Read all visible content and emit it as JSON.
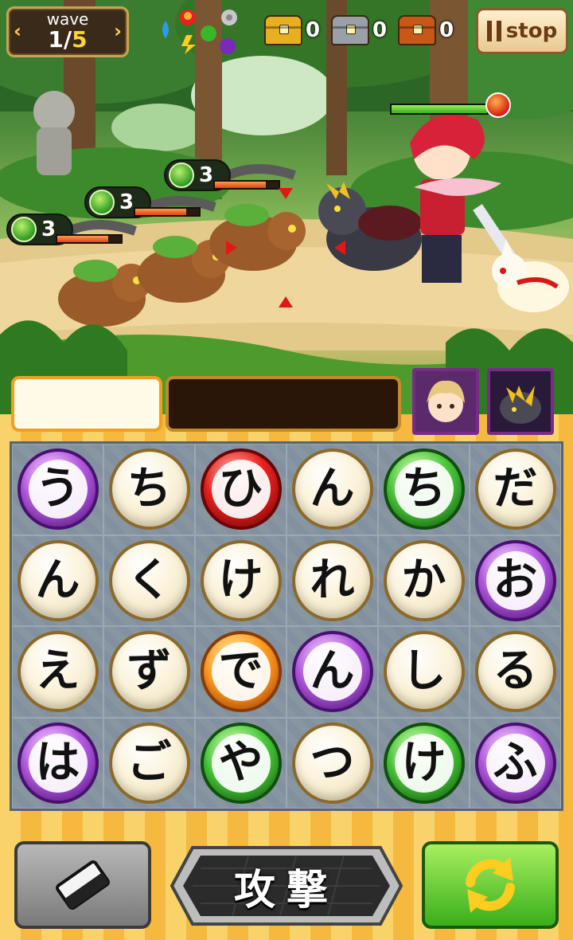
{
  "hud": {
    "wave_label": "wave",
    "wave_current": "1",
    "wave_sep": "/",
    "wave_total": "5",
    "element_icons": [
      "water-drop-icon",
      "fire-icon",
      "leaf-icon",
      "lightning-icon",
      "dark-icon",
      "flower-icon"
    ],
    "chests": [
      {
        "type": "gold-chest-icon",
        "count": "0",
        "color": "#e8b020"
      },
      {
        "type": "silver-chest-icon",
        "count": "0",
        "color": "#9aa0a8"
      },
      {
        "type": "bronze-chest-icon",
        "count": "0",
        "color": "#c8581a"
      }
    ],
    "stop_label": "stop"
  },
  "enemies": [
    {
      "level": "3",
      "hp": 0.8
    },
    {
      "level": "3",
      "hp": 0.8
    },
    {
      "level": "3",
      "hp": 0.8
    }
  ],
  "ally": {
    "hp": 1.0,
    "element": "fire"
  },
  "word_bar": {
    "current_word": ""
  },
  "party_portraits": [
    "blonde-girl-portrait",
    "dark-wolf-portrait"
  ],
  "grid": {
    "rows": [
      [
        {
          "char": "う",
          "color": "purple"
        },
        {
          "char": "ち",
          "color": "white"
        },
        {
          "char": "ひ",
          "color": "red"
        },
        {
          "char": "ん",
          "color": "white"
        },
        {
          "char": "ち",
          "color": "green"
        },
        {
          "char": "だ",
          "color": "white"
        }
      ],
      [
        {
          "char": "ん",
          "color": "white"
        },
        {
          "char": "く",
          "color": "white"
        },
        {
          "char": "け",
          "color": "white"
        },
        {
          "char": "れ",
          "color": "white"
        },
        {
          "char": "か",
          "color": "white"
        },
        {
          "char": "お",
          "color": "purple"
        }
      ],
      [
        {
          "char": "え",
          "color": "white"
        },
        {
          "char": "ず",
          "color": "white"
        },
        {
          "char": "で",
          "color": "orange"
        },
        {
          "char": "ん",
          "color": "purple"
        },
        {
          "char": "し",
          "color": "white"
        },
        {
          "char": "る",
          "color": "white"
        }
      ],
      [
        {
          "char": "は",
          "color": "purple"
        },
        {
          "char": "ご",
          "color": "white"
        },
        {
          "char": "や",
          "color": "green"
        },
        {
          "char": "つ",
          "color": "white"
        },
        {
          "char": "け",
          "color": "green"
        },
        {
          "char": "ふ",
          "color": "purple"
        }
      ]
    ]
  },
  "actions": {
    "attack_label": "攻撃",
    "erase_icon": "eraser-icon",
    "refresh_icon": "refresh-icon"
  }
}
